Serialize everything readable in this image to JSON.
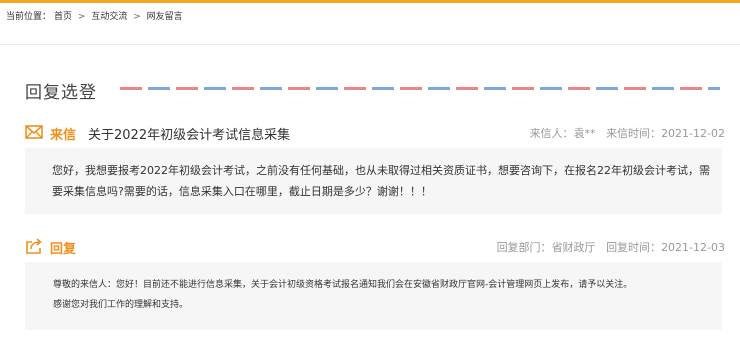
{
  "breadcrumb": {
    "prefix": "当前位置：",
    "items": [
      "首页",
      "互动交流",
      "网友留言"
    ],
    "separator": ">"
  },
  "section": {
    "title": "回复选登"
  },
  "letter": {
    "icon": "envelope-icon",
    "tag": "来信",
    "subject": "关于2022年初级会计考试信息采集",
    "sender_label": "来信人：",
    "sender": "袁**",
    "date_label": "来信时间：",
    "date": "2021-12-02",
    "body": "您好，我想要报考2022年初级会计考试，之前没有任何基础，也从未取得过相关资质证书，想要咨询下，在报名22年初级会计考试，需要采集信息吗?需要的话，信息采集入口在哪里，截止日期是多少？谢谢！！！"
  },
  "reply": {
    "icon": "reply-share-icon",
    "tag": "回复",
    "dept_label": "回复部门：",
    "dept": "省财政厅",
    "date_label": "回复时间：",
    "date": "2021-12-03",
    "lines": [
      "尊敬的来信人：您好！目前还不能进行信息采集，关于会计初级资格考试报名通知我们会在安徽省财政厅官网-会计管理网页上发布，请予以关注。",
      "感谢您对我们工作的理解和支持。"
    ]
  },
  "colors": {
    "accent": "#f0911f",
    "top_bar": "#f5a623",
    "box_bg": "#f6f6f6",
    "air_red": "#e8868b",
    "air_blue": "#7ea7dc"
  }
}
